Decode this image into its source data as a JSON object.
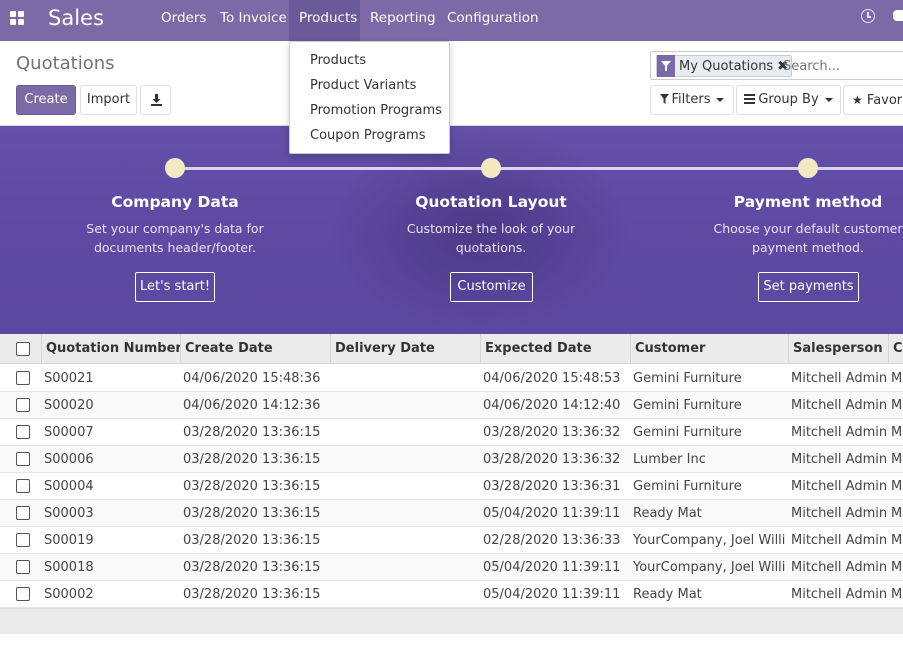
{
  "navbar": {
    "brand": "Sales",
    "menu": [
      "Orders",
      "To Invoice",
      "Products",
      "Reporting",
      "Configuration"
    ],
    "active_menu": "Products",
    "bg_color": "#7c6aa6"
  },
  "control": {
    "title": "Quotations",
    "create_label": "Create",
    "import_label": "Import",
    "facet_label": "My Quotations",
    "facet_remove": "✖",
    "search_placeholder": "Search...",
    "filters_label": "Filters",
    "groupby_label": "Group By",
    "favorites_label": "Favorites"
  },
  "dropdown": {
    "items": [
      "Products",
      "Product Variants",
      "Promotion Programs",
      "Coupon Programs"
    ]
  },
  "onboarding": {
    "steps": [
      {
        "title": "Company Data",
        "desc1": "Set your company's data for",
        "desc2": "documents header/footer.",
        "button": "Let's start!"
      },
      {
        "title": "Quotation Layout",
        "desc1": "Customize the look of your",
        "desc2": "quotations.",
        "button": "Customize"
      },
      {
        "title": "Payment method",
        "desc1": "Choose your default customer",
        "desc2": "payment method.",
        "button": "Set payments"
      }
    ]
  },
  "table": {
    "columns": [
      "Quotation Number",
      "Create Date",
      "Delivery Date",
      "Expected Date",
      "Customer",
      "Salesperson",
      "Co"
    ],
    "rows": [
      [
        "S00021",
        "04/06/2020 15:48:36",
        "",
        "04/06/2020 15:48:53",
        "Gemini Furniture",
        "Mitchell Admin",
        "M"
      ],
      [
        "S00020",
        "04/06/2020 14:12:36",
        "",
        "04/06/2020 14:12:40",
        "Gemini Furniture",
        "Mitchell Admin",
        "M"
      ],
      [
        "S00007",
        "03/28/2020 13:36:15",
        "",
        "03/28/2020 13:36:32",
        "Gemini Furniture",
        "Mitchell Admin",
        "M"
      ],
      [
        "S00006",
        "03/28/2020 13:36:15",
        "",
        "03/28/2020 13:36:32",
        "Lumber Inc",
        "Mitchell Admin",
        "M"
      ],
      [
        "S00004",
        "03/28/2020 13:36:15",
        "",
        "03/28/2020 13:36:31",
        "Gemini Furniture",
        "Mitchell Admin",
        "M"
      ],
      [
        "S00003",
        "03/28/2020 13:36:15",
        "",
        "05/04/2020 11:39:11",
        "Ready Mat",
        "Mitchell Admin",
        "M"
      ],
      [
        "S00019",
        "03/28/2020 13:36:15",
        "",
        "02/28/2020 13:36:33",
        "YourCompany, Joel Willis",
        "Mitchell Admin",
        "M"
      ],
      [
        "S00018",
        "03/28/2020 13:36:15",
        "",
        "05/04/2020 11:39:11",
        "YourCompany, Joel Willis",
        "Mitchell Admin",
        "M"
      ],
      [
        "S00002",
        "03/28/2020 13:36:15",
        "",
        "05/04/2020 11:39:11",
        "Ready Mat",
        "Mitchell Admin",
        "M"
      ]
    ]
  }
}
